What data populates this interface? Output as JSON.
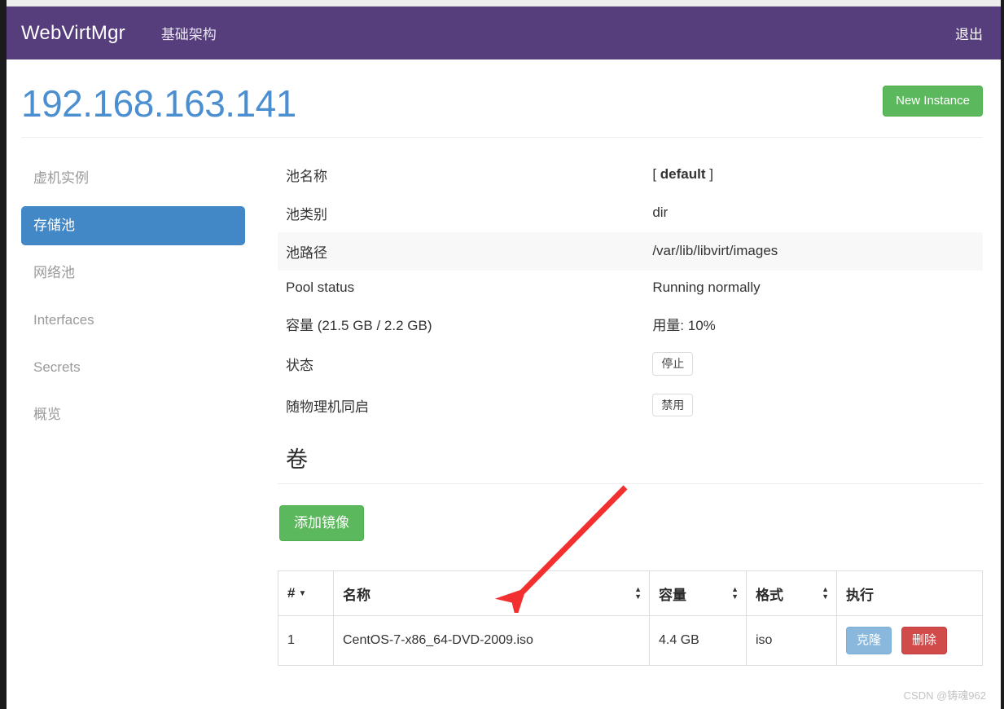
{
  "navbar": {
    "brand": "WebVirtMgr",
    "links": [
      {
        "label": "基础架构",
        "name": "nav-infrastructure"
      }
    ],
    "logout_label": "退出",
    "background": "#563d7c"
  },
  "header": {
    "title": "192.168.163.141",
    "title_color": "#4b8fd0",
    "new_instance_label": "New Instance",
    "new_instance_color": "#5cb85c"
  },
  "sidebar": {
    "active_color": "#4287c6",
    "items": [
      {
        "label": "虚机实例",
        "name": "sidebar-item-instances",
        "active": false
      },
      {
        "label": "存储池",
        "name": "sidebar-item-storages",
        "active": true
      },
      {
        "label": "网络池",
        "name": "sidebar-item-networks",
        "active": false
      },
      {
        "label": "Interfaces",
        "name": "sidebar-item-interfaces",
        "active": false
      },
      {
        "label": "Secrets",
        "name": "sidebar-item-secrets",
        "active": false
      },
      {
        "label": "概览",
        "name": "sidebar-item-overview",
        "active": false
      }
    ]
  },
  "pool_details": {
    "rows": [
      {
        "key": "池名称",
        "value_prefix": "[ ",
        "value_bold": "default",
        "value_suffix": " ]",
        "striped": false
      },
      {
        "key": "池类别",
        "value": "dir",
        "striped": false
      },
      {
        "key": "池路径",
        "value": "/var/lib/libvirt/images",
        "striped": true
      },
      {
        "key": "Pool status",
        "value": "Running normally",
        "striped": false
      },
      {
        "key": "容量 (21.5 GB / 2.2 GB)",
        "value": "用量: 10%",
        "striped": false
      },
      {
        "key": "状态",
        "button": "停止",
        "striped": false
      },
      {
        "key": "随物理机同启",
        "button": "禁用",
        "striped": false
      }
    ]
  },
  "volumes": {
    "section_title": "卷",
    "add_image_label": "添加镜像",
    "add_image_color": "#5cb85c",
    "columns": [
      {
        "label": "#",
        "name": "col-index",
        "sort": "caret"
      },
      {
        "label": "名称",
        "name": "col-name",
        "sort": "both"
      },
      {
        "label": "容量",
        "name": "col-size",
        "sort": "both"
      },
      {
        "label": "格式",
        "name": "col-format",
        "sort": "both"
      },
      {
        "label": "执行",
        "name": "col-actions",
        "sort": "none"
      }
    ],
    "rows": [
      {
        "index": "1",
        "name": "CentOS-7-x86_64-DVD-2009.iso",
        "size": "4.4 GB",
        "format": "iso",
        "clone_label": "克隆",
        "delete_label": "删除"
      }
    ],
    "clone_color": "#89b8dc",
    "delete_color": "#d24b4b"
  },
  "annotation": {
    "arrow_color": "#f23030"
  },
  "watermark": {
    "text": "CSDN @铸魂962"
  }
}
